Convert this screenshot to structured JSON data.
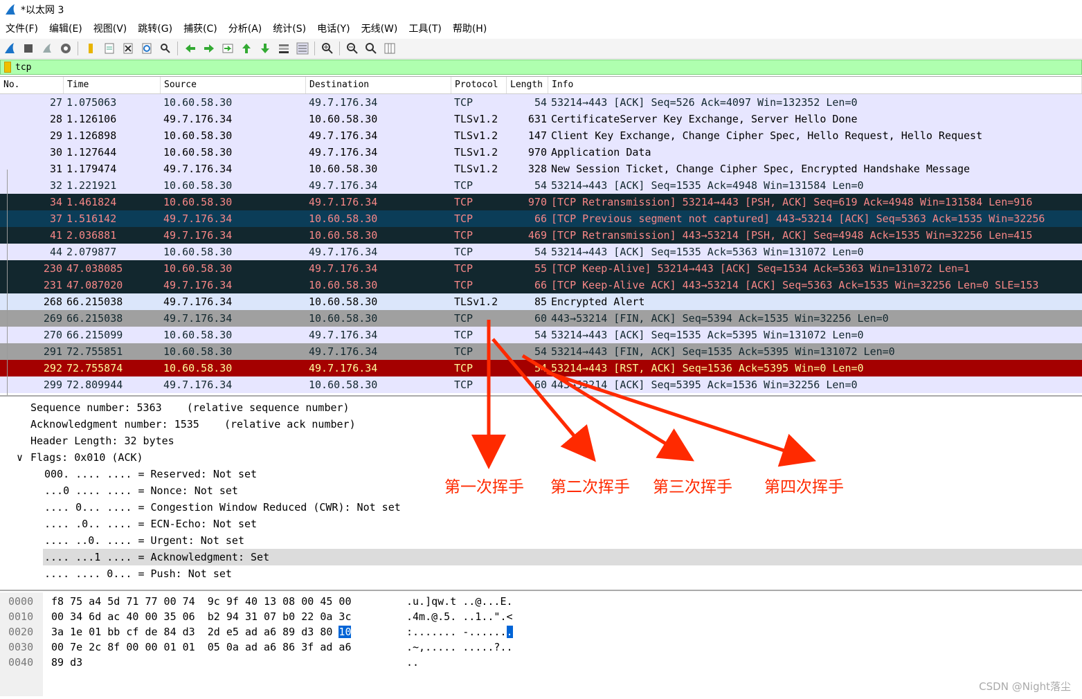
{
  "window": {
    "title": "*以太网 3"
  },
  "menu": [
    "文件(F)",
    "编辑(E)",
    "视图(V)",
    "跳转(G)",
    "捕获(C)",
    "分析(A)",
    "统计(S)",
    "电话(Y)",
    "无线(W)",
    "工具(T)",
    "帮助(H)"
  ],
  "toolbar_icons": [
    "shark-fin-start-icon",
    "stop-icon",
    "restart-icon",
    "options-gear-icon",
    "open-file-icon",
    "save-file-icon",
    "close-file-icon",
    "reload-icon",
    "find-icon",
    "go-back-icon",
    "go-forward-icon",
    "go-to-packet-icon",
    "first-packet-icon",
    "last-packet-icon",
    "autoscroll-icon",
    "colorize-icon",
    "zoom-in-icon",
    "zoom-out-icon",
    "zoom-normal-icon",
    "resize-columns-icon"
  ],
  "filter": {
    "value": "tcp"
  },
  "columns": [
    "No.",
    "Time",
    "Source",
    "Destination",
    "Protocol",
    "Length",
    "Info"
  ],
  "packets": [
    {
      "no": "27",
      "time": "1.075063",
      "src": "10.60.58.30",
      "dst": "49.7.176.34",
      "proto": "TCP",
      "len": "54",
      "info": "53214→443 [ACK] Seq=526 Ack=4097 Win=132352 Len=0",
      "style": "light"
    },
    {
      "no": "28",
      "time": "1.126106",
      "src": "49.7.176.34",
      "dst": "10.60.58.30",
      "proto": "TLSv1.2",
      "len": "631",
      "info": "CertificateServer Key Exchange, Server Hello Done",
      "style": "tls"
    },
    {
      "no": "29",
      "time": "1.126898",
      "src": "10.60.58.30",
      "dst": "49.7.176.34",
      "proto": "TLSv1.2",
      "len": "147",
      "info": "Client Key Exchange, Change Cipher Spec, Hello Request, Hello Request",
      "style": "tls"
    },
    {
      "no": "30",
      "time": "1.127644",
      "src": "10.60.58.30",
      "dst": "49.7.176.34",
      "proto": "TLSv1.2",
      "len": "970",
      "info": "Application Data",
      "style": "tls"
    },
    {
      "no": "31",
      "time": "1.179474",
      "src": "49.7.176.34",
      "dst": "10.60.58.30",
      "proto": "TLSv1.2",
      "len": "328",
      "info": "New Session Ticket, Change Cipher Spec, Encrypted Handshake Message",
      "style": "tls"
    },
    {
      "no": "32",
      "time": "1.221921",
      "src": "10.60.58.30",
      "dst": "49.7.176.34",
      "proto": "TCP",
      "len": "54",
      "info": "53214→443 [ACK] Seq=1535 Ack=4948 Win=131584 Len=0",
      "style": "light"
    },
    {
      "no": "34",
      "time": "1.461824",
      "src": "10.60.58.30",
      "dst": "49.7.176.34",
      "proto": "TCP",
      "len": "970",
      "info": "[TCP Retransmission] 53214→443 [PSH, ACK] Seq=619 Ack=4948 Win=131584 Len=916",
      "style": "dark"
    },
    {
      "no": "37",
      "time": "1.516142",
      "src": "49.7.176.34",
      "dst": "10.60.58.30",
      "proto": "TCP",
      "len": "66",
      "info": "[TCP Previous segment not captured] 443→53214 [ACK] Seq=5363 Ack=1535 Win=32256",
      "style": "blue"
    },
    {
      "no": "41",
      "time": "2.036881",
      "src": "49.7.176.34",
      "dst": "10.60.58.30",
      "proto": "TCP",
      "len": "469",
      "info": "[TCP Retransmission] 443→53214 [PSH, ACK] Seq=4948 Ack=1535 Win=32256 Len=415",
      "style": "dark"
    },
    {
      "no": "44",
      "time": "2.079877",
      "src": "10.60.58.30",
      "dst": "49.7.176.34",
      "proto": "TCP",
      "len": "54",
      "info": "53214→443 [ACK] Seq=1535 Ack=5363 Win=131072 Len=0",
      "style": "light"
    },
    {
      "no": "230",
      "time": "47.038085",
      "src": "10.60.58.30",
      "dst": "49.7.176.34",
      "proto": "TCP",
      "len": "55",
      "info": "[TCP Keep-Alive] 53214→443 [ACK] Seq=1534 Ack=5363 Win=131072 Len=1",
      "style": "dark"
    },
    {
      "no": "231",
      "time": "47.087020",
      "src": "49.7.176.34",
      "dst": "10.60.58.30",
      "proto": "TCP",
      "len": "66",
      "info": "[TCP Keep-Alive ACK] 443→53214 [ACK] Seq=5363 Ack=1535 Win=32256 Len=0 SLE=153",
      "style": "dark"
    },
    {
      "no": "268",
      "time": "66.215038",
      "src": "49.7.176.34",
      "dst": "10.60.58.30",
      "proto": "TLSv1.2",
      "len": "85",
      "info": "Encrypted Alert",
      "style": "tlsalert"
    },
    {
      "no": "269",
      "time": "66.215038",
      "src": "49.7.176.34",
      "dst": "10.60.58.30",
      "proto": "TCP",
      "len": "60",
      "info": "443→53214 [FIN, ACK] Seq=5394 Ack=1535 Win=32256 Len=0",
      "style": "gray"
    },
    {
      "no": "270",
      "time": "66.215099",
      "src": "10.60.58.30",
      "dst": "49.7.176.34",
      "proto": "TCP",
      "len": "54",
      "info": "53214→443 [ACK] Seq=1535 Ack=5395 Win=131072 Len=0",
      "style": "light"
    },
    {
      "no": "291",
      "time": "72.755851",
      "src": "10.60.58.30",
      "dst": "49.7.176.34",
      "proto": "TCP",
      "len": "54",
      "info": "53214→443 [FIN, ACK] Seq=1535 Ack=5395 Win=131072 Len=0",
      "style": "gray"
    },
    {
      "no": "292",
      "time": "72.755874",
      "src": "10.60.58.30",
      "dst": "49.7.176.34",
      "proto": "TCP",
      "len": "54",
      "info": "53214→443 [RST, ACK] Seq=1536 Ack=5395 Win=0 Len=0",
      "style": "red"
    },
    {
      "no": "299",
      "time": "72.809944",
      "src": "49.7.176.34",
      "dst": "10.60.58.30",
      "proto": "TCP",
      "len": "60",
      "info": "443→53214 [ACK] Seq=5395 Ack=1536 Win=32256 Len=0",
      "style": "light"
    }
  ],
  "details": [
    {
      "text": "Sequence number: 5363    (relative sequence number)",
      "indent": 0
    },
    {
      "text": "Acknowledgment number: 1535    (relative ack number)",
      "indent": 0
    },
    {
      "text": "Header Length: 32 bytes",
      "indent": 0
    },
    {
      "text": "Flags: 0x010 (ACK)",
      "indent": 0,
      "expander": "∨"
    },
    {
      "text": "000. .... .... = Reserved: Not set",
      "indent": 1
    },
    {
      "text": "...0 .... .... = Nonce: Not set",
      "indent": 1
    },
    {
      "text": ".... 0... .... = Congestion Window Reduced (CWR): Not set",
      "indent": 1
    },
    {
      "text": ".... .0.. .... = ECN-Echo: Not set",
      "indent": 1
    },
    {
      "text": ".... ..0. .... = Urgent: Not set",
      "indent": 1
    },
    {
      "text": ".... ...1 .... = Acknowledgment: Set",
      "indent": 1,
      "selected": true
    },
    {
      "text": ".... .... 0... = Push: Not set",
      "indent": 1
    }
  ],
  "hex": [
    {
      "offset": "0000",
      "bytes": "f8 75 a4 5d 71 77 00 74  9c 9f 40 13 08 00 45 00",
      "ascii": ".u.]qw.t ..@...E."
    },
    {
      "offset": "0010",
      "bytes": "00 34 6d ac 40 00 35 06  b2 94 31 07 b0 22 0a 3c",
      "ascii": ".4m.@.5. ..1..\".<"
    },
    {
      "offset": "0020",
      "bytes": "3a 1e 01 bb cf de 84 d3  2d e5 ad a6 89 d3 80 ",
      "sel_byte": "10",
      "ascii": ":....... -......",
      "sel_ascii": "."
    },
    {
      "offset": "0030",
      "bytes": "00 7e 2c 8f 00 00 01 01  05 0a ad a6 86 3f ad a6",
      "ascii": ".~,..... .....?.."
    },
    {
      "offset": "0040",
      "bytes": "89 d3",
      "ascii": ".."
    }
  ],
  "annotations": {
    "first": "第一次挥手",
    "second": "第二次挥手",
    "third": "第三次挥手",
    "fourth": "第四次挥手",
    "color": "#ff2a00"
  },
  "watermark": "CSDN @Night落尘"
}
